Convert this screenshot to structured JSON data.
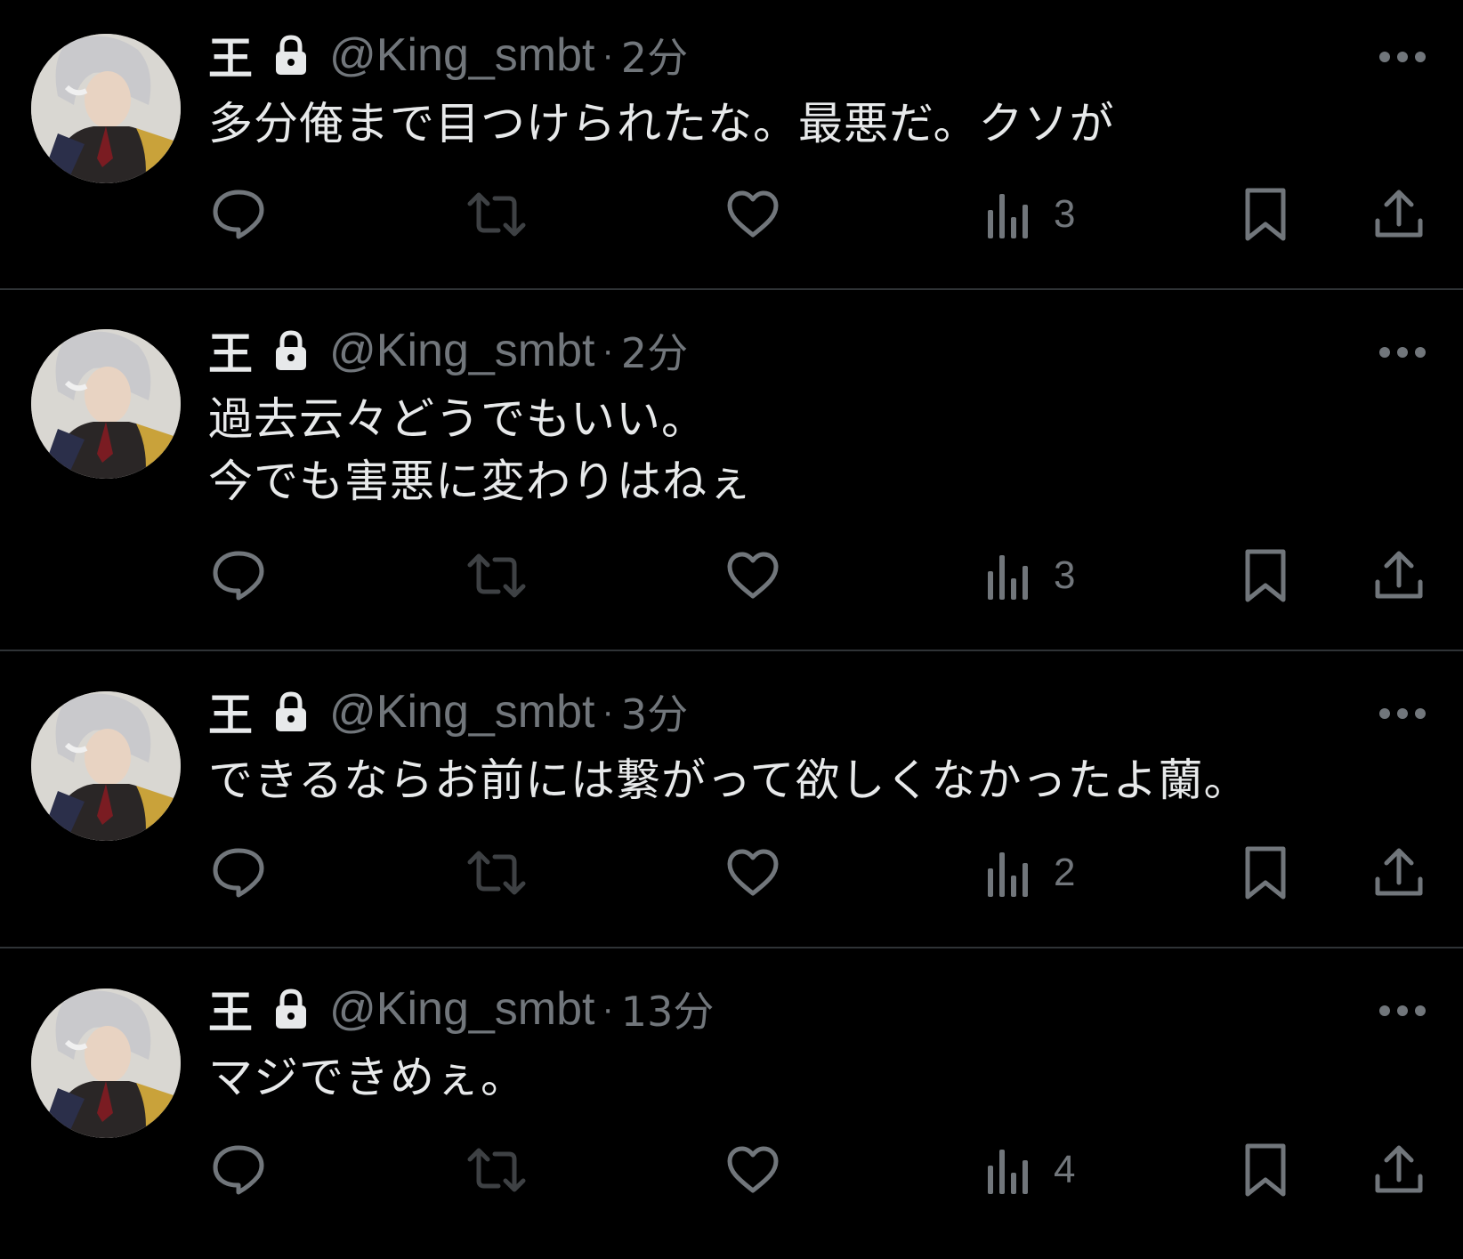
{
  "colors": {
    "background": "#000000",
    "text_primary": "#e7e9ea",
    "text_secondary": "#71767b",
    "retweet_disabled": "#3e4144",
    "divider": "#2f3336"
  },
  "icons": {
    "lock": "lock-icon",
    "more": "more-horizontal-icon",
    "reply": "reply-bubble-icon",
    "retweet": "retweet-icon",
    "like": "heart-icon",
    "views": "bar-chart-icon",
    "bookmark": "bookmark-icon",
    "share": "share-icon"
  },
  "tweets": [
    {
      "display_name": "王",
      "handle": "@King_smbt",
      "separator": "·",
      "time": "2分",
      "text": "多分俺まで目つけられたな。最悪だ。クソが",
      "views": "3"
    },
    {
      "display_name": "王",
      "handle": "@King_smbt",
      "separator": "·",
      "time": "2分",
      "text": "過去云々どうでもいい。\n今でも害悪に変わりはねぇ",
      "views": "3"
    },
    {
      "display_name": "王",
      "handle": "@King_smbt",
      "separator": "·",
      "time": "3分",
      "text": "できるならお前には繋がって欲しくなかったよ蘭。",
      "views": "2"
    },
    {
      "display_name": "王",
      "handle": "@King_smbt",
      "separator": "·",
      "time": "13分",
      "text": "マジできめぇ。",
      "views": "4"
    }
  ]
}
